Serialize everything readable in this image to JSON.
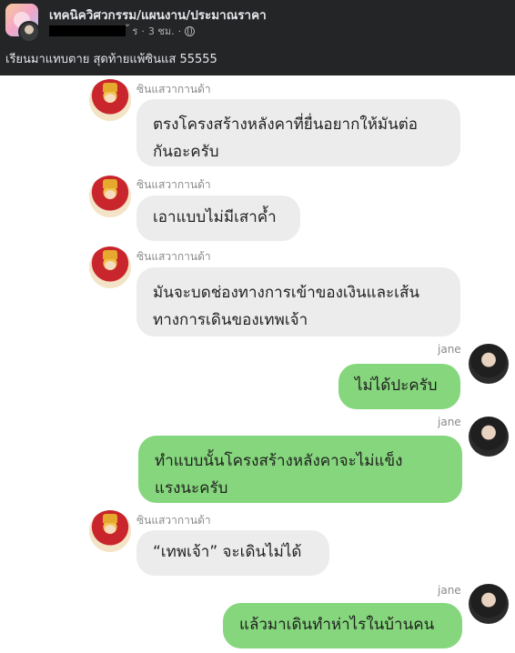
{
  "post": {
    "group_name": "เทคนิควิศวกรรม/แผนงาน/ประมาณราคา",
    "author_tail": "้ ร",
    "time": "3 ชม.",
    "separator": "·",
    "privacy_icon": "globe-icon",
    "caption": "เรียนมาแทบตาย สุดท้ายแพ้ซินแส 55555"
  },
  "chat": {
    "colors": {
      "incoming_bubble": "#ececec",
      "outgoing_bubble": "#85d67c"
    },
    "messages": [
      {
        "sender": "ซินแสวากานด้า",
        "lines": [
          "ตรงโครงสร้างหลังคาที่ยื่นอยากให้มันต่อ",
          "กันอะครับ"
        ]
      },
      {
        "sender": "ซินแสวากานด้า",
        "lines": [
          "เอาแบบไม่มีเสาค้ำ"
        ]
      },
      {
        "sender": "ซินแสวากานด้า",
        "lines": [
          "มันจะบดช่องทางการเข้าของเงินและเส้น",
          "ทางการเดินของเทพเจ้า"
        ]
      },
      {
        "sender": "jane",
        "lines": [
          "ไม่ได้ปะครับ"
        ]
      },
      {
        "sender": "jane",
        "lines": [
          "ทำแบบนั้นโครงสร้างหลังคาจะไม่แข็ง",
          "แรงนะครับ"
        ]
      },
      {
        "sender": "ซินแสวากานด้า",
        "lines": [
          "“เทพเจ้า” จะเดินไม่ได้"
        ]
      },
      {
        "sender": "jane",
        "lines": [
          "แล้วมาเดินทำห่าไรในบ้านคน"
        ]
      }
    ]
  }
}
